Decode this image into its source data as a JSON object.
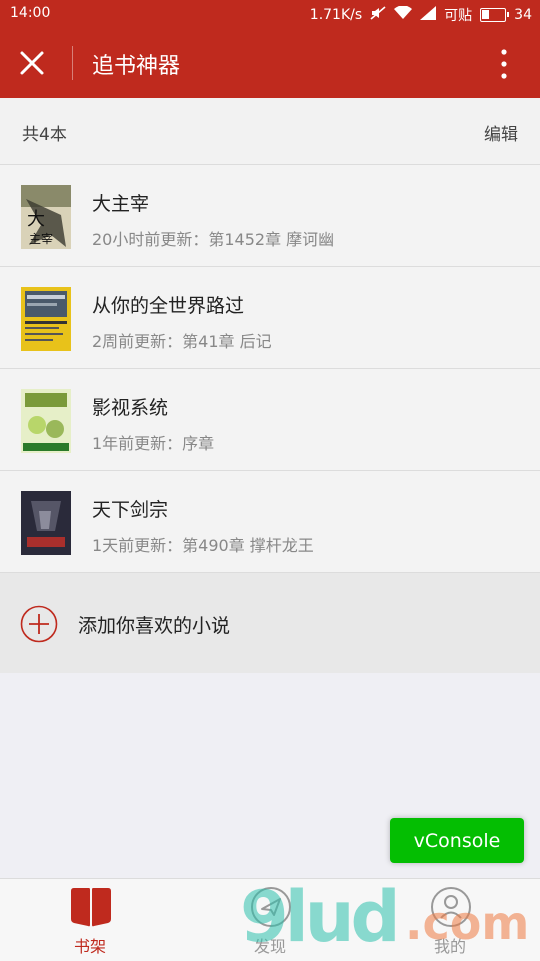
{
  "status_bar": {
    "time": "14:00",
    "speed": "1.71K/s",
    "carrier": "可贴",
    "battery": "34",
    "battery_level": 0.34
  },
  "title_bar": {
    "title": "追书神器",
    "close_icon": "close-icon",
    "more_icon": "more-vertical-icon"
  },
  "shelf": {
    "count_label": "共4本",
    "edit_label": "编辑"
  },
  "books": [
    {
      "title": "大主宰",
      "update": "20小时前更新：第1452章 摩诃幽",
      "cover_colors": [
        "#3a3a30",
        "#d9d2b8"
      ]
    },
    {
      "title": "从你的全世界路过",
      "update": "2周前更新：第41章 后记",
      "cover_colors": [
        "#e8c21a",
        "#4a5a6a"
      ]
    },
    {
      "title": "影视系统",
      "update": "1年前更新：序章",
      "cover_colors": [
        "#b8d66a",
        "#7a9a3a"
      ]
    },
    {
      "title": "天下剑宗",
      "update": "1天前更新：第490章 撑杆龙王",
      "cover_colors": [
        "#2a2a3a",
        "#6a6a7a"
      ]
    }
  ],
  "add_row": {
    "label": "添加你喜欢的小说",
    "icon": "plus-circle-icon"
  },
  "vconsole": {
    "label": "vConsole"
  },
  "tabs": [
    {
      "label": "书架",
      "icon": "bookshelf-icon",
      "active": true
    },
    {
      "label": "发现",
      "icon": "compass-icon",
      "active": false
    },
    {
      "label": "我的",
      "icon": "user-icon",
      "active": false
    }
  ],
  "watermark": {
    "main": "9lud",
    "suffix": ".com"
  },
  "colors": {
    "brand_red": "#bf2a1e",
    "vconsole_green": "#04be02"
  }
}
